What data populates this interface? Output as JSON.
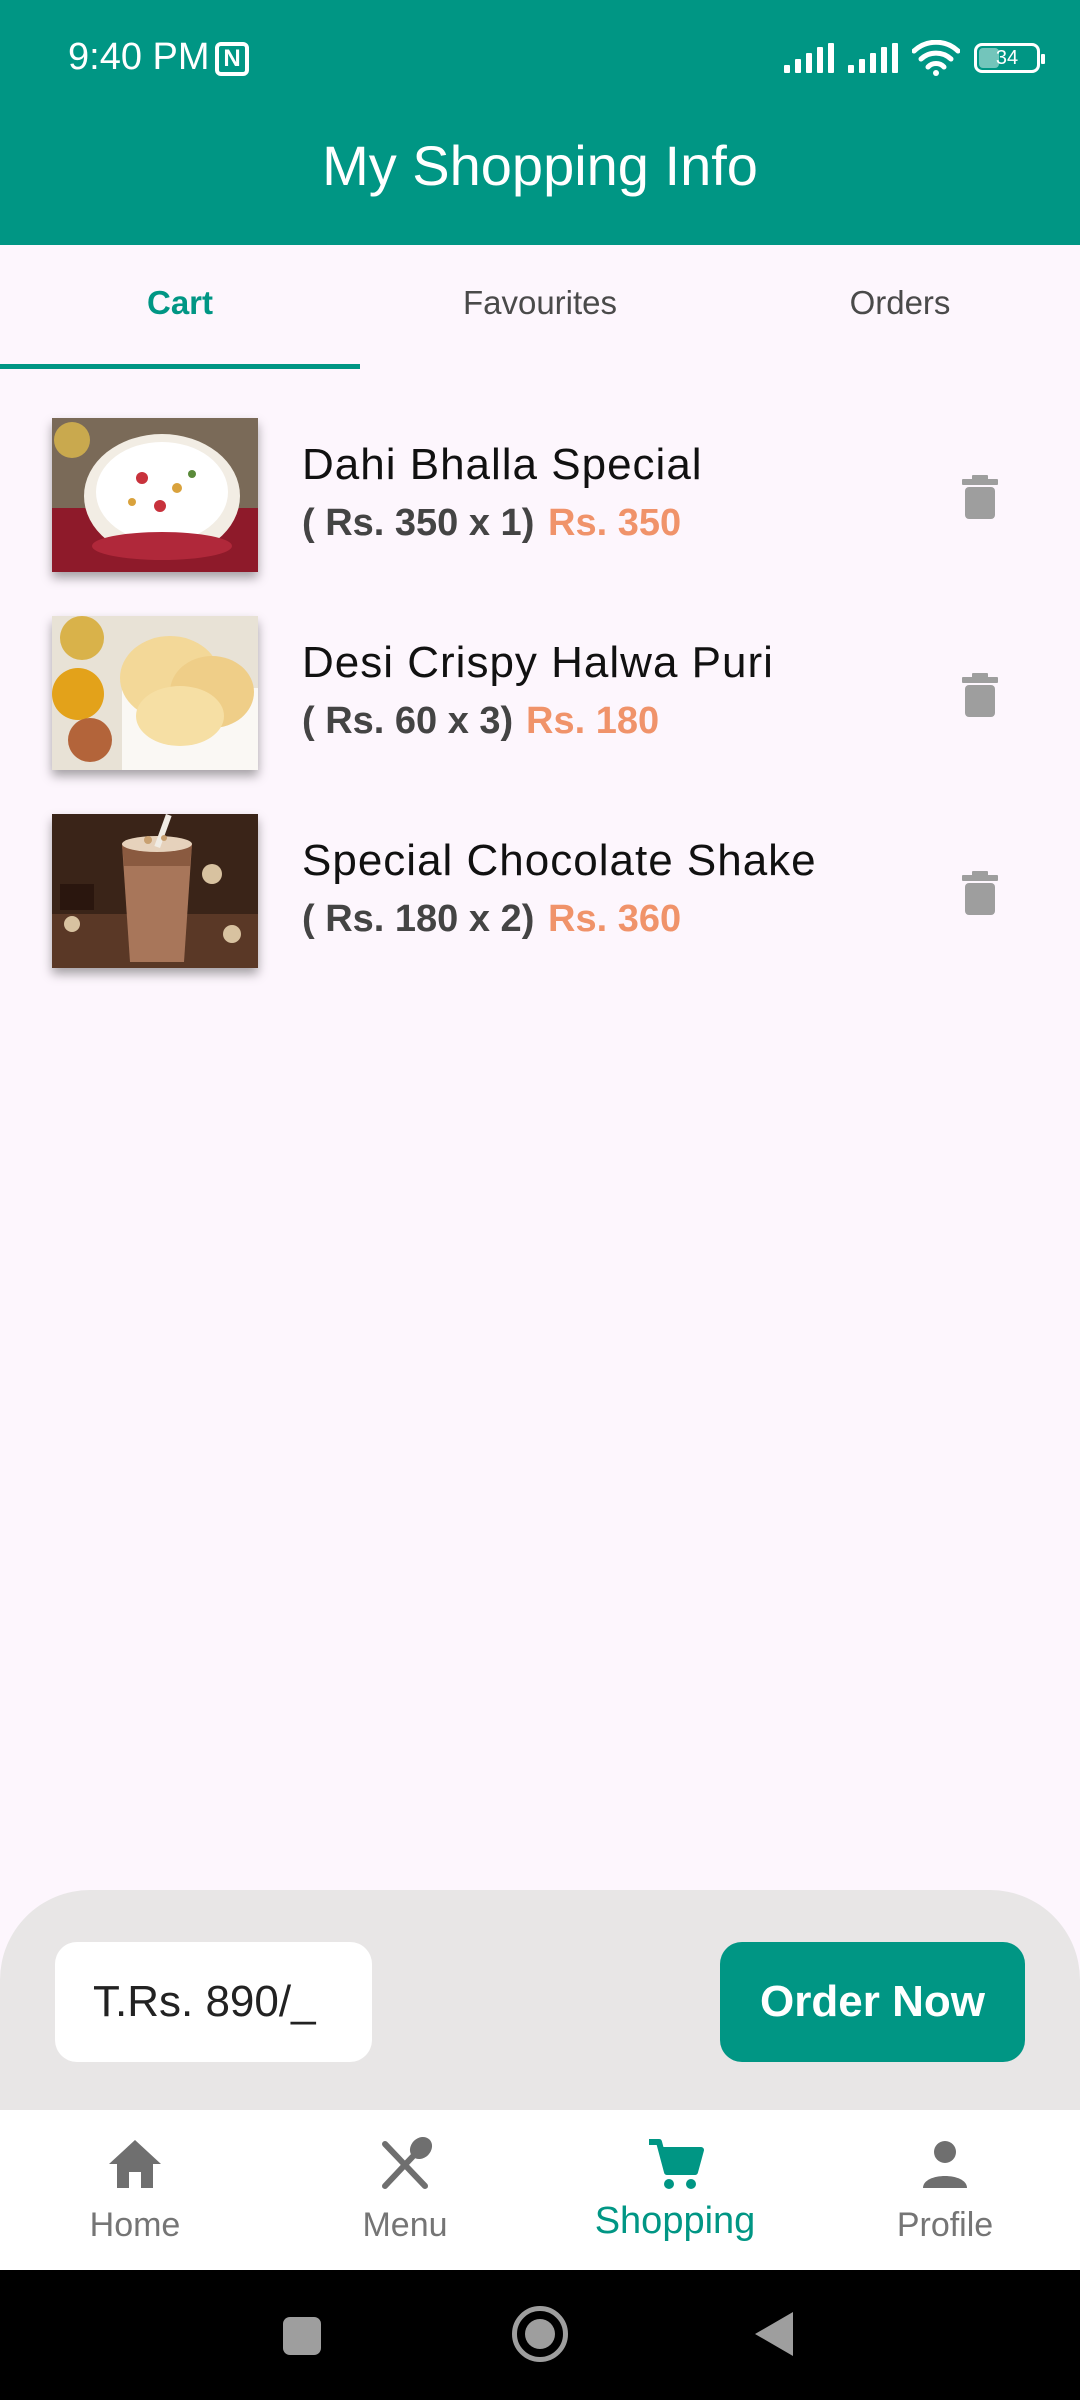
{
  "status_bar": {
    "time": "9:40 PM",
    "battery": "34"
  },
  "app_bar": {
    "title": "My Shopping Info"
  },
  "tabs": [
    {
      "label": "Cart",
      "active": true
    },
    {
      "label": "Favourites",
      "active": false
    },
    {
      "label": "Orders",
      "active": false
    }
  ],
  "cart": {
    "items": [
      {
        "name": "Dahi Bhalla Special",
        "qty_text": "( Rs. 350 x 1)",
        "total": "Rs. 350",
        "image": "dahi-bhalla-photo"
      },
      {
        "name": "Desi Crispy Halwa Puri",
        "qty_text": "( Rs. 60 x 3)",
        "total": "Rs. 180",
        "image": "halwa-puri-photo"
      },
      {
        "name": "Special Chocolate Shake",
        "qty_text": "( Rs. 180 x 2)",
        "total": "Rs. 360",
        "image": "chocolate-shake-photo"
      }
    ]
  },
  "footer": {
    "total": "T.Rs. 890/_",
    "order_label": "Order Now"
  },
  "bottom_nav": [
    {
      "label": "Home",
      "icon": "home-icon",
      "active": false
    },
    {
      "label": "Menu",
      "icon": "utensils-icon",
      "active": false
    },
    {
      "label": "Shopping",
      "icon": "cart-icon",
      "active": true
    },
    {
      "label": "Profile",
      "icon": "person-icon",
      "active": false
    }
  ],
  "colors": {
    "primary": "#009684",
    "price_accent": "#f0936a",
    "background": "#fdf6fd",
    "footer_bg": "#e8e6e6"
  }
}
